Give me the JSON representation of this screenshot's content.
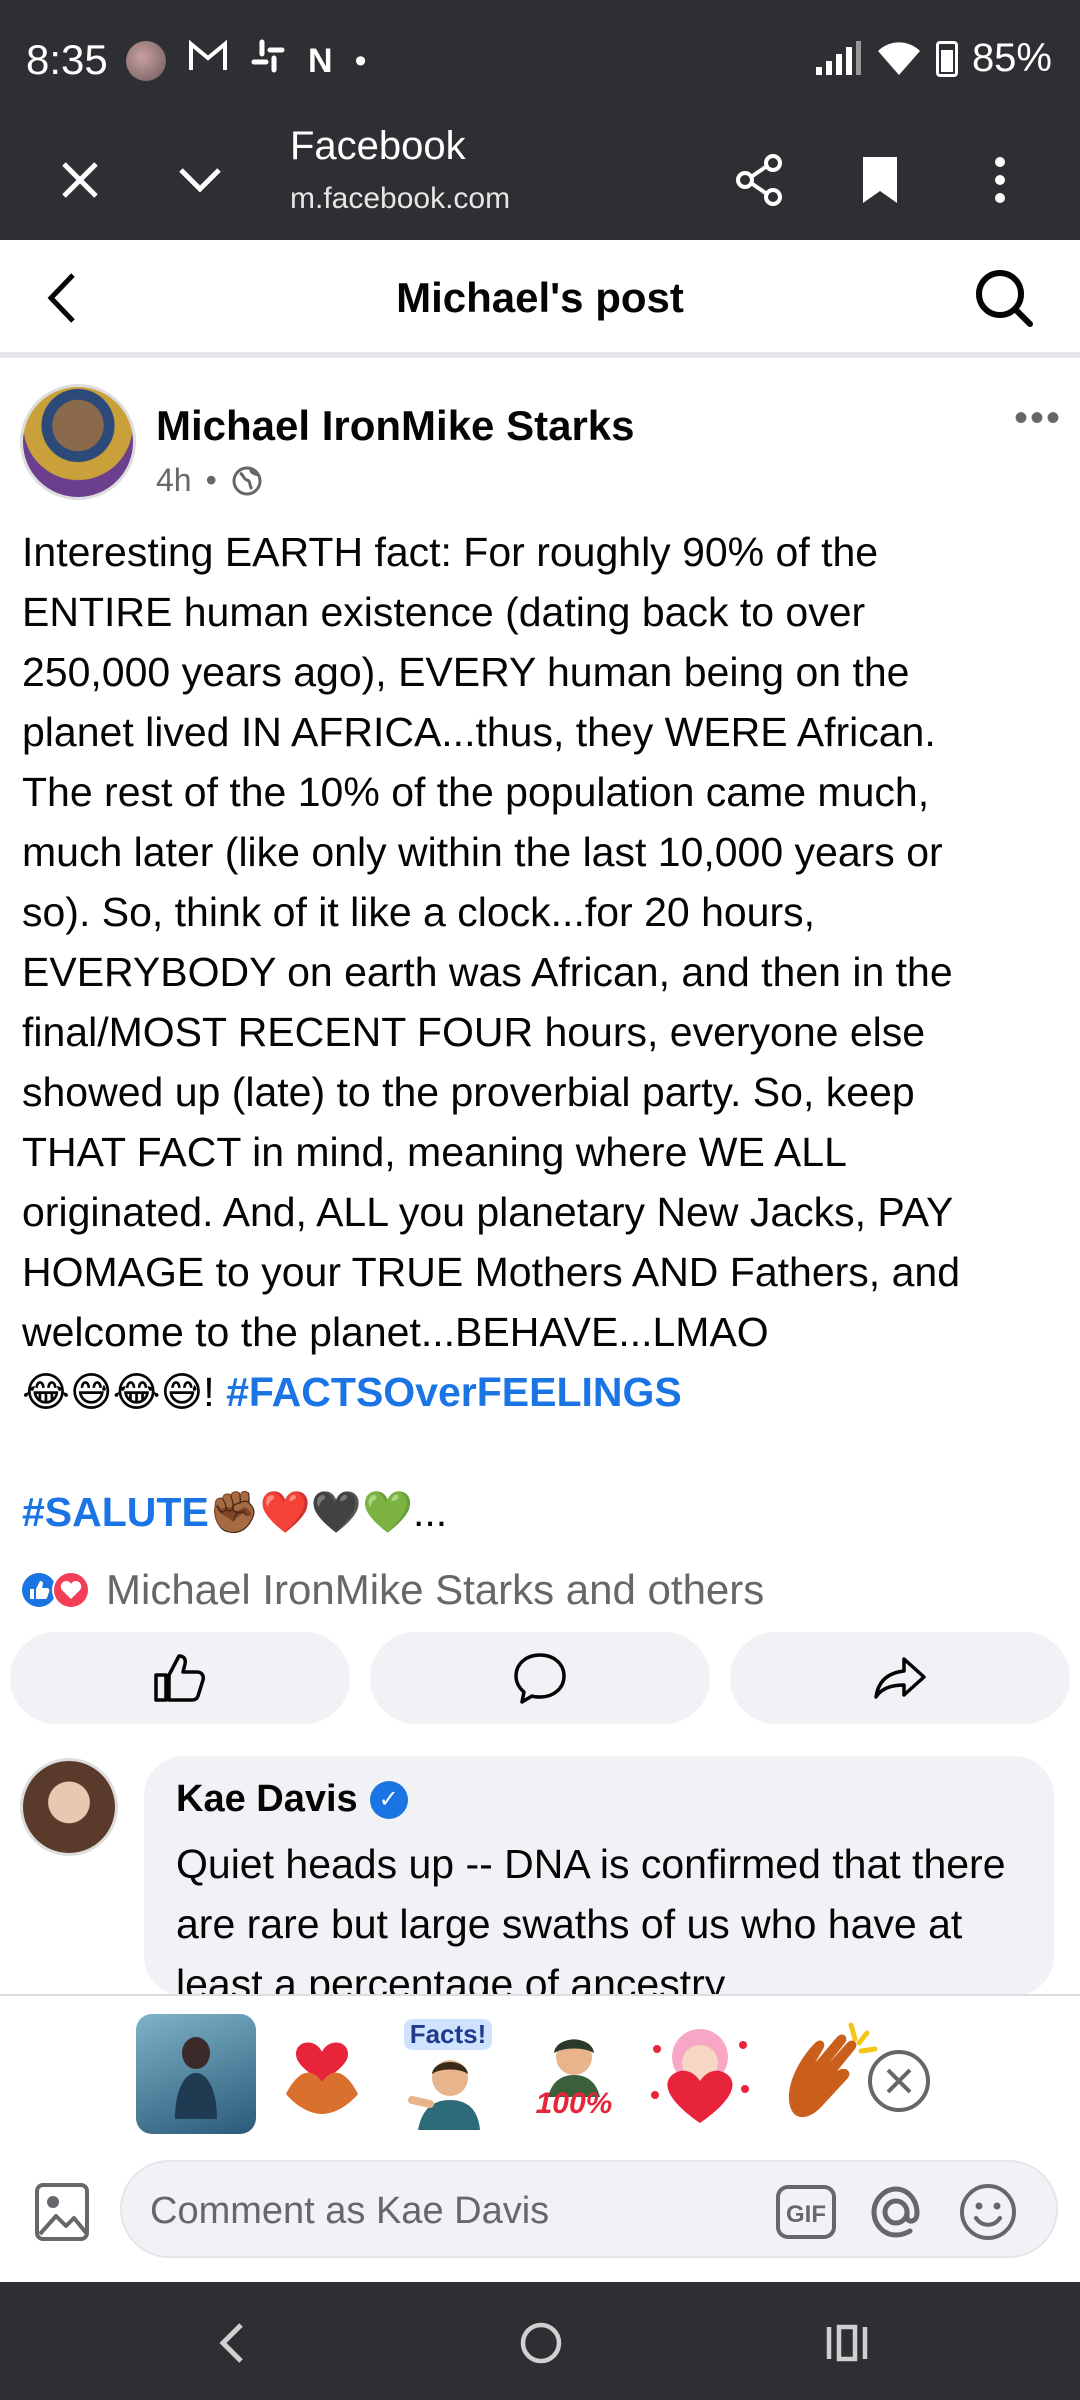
{
  "status_bar": {
    "time": "8:35",
    "icons": [
      "gallery-thumb-icon",
      "gmail-icon",
      "slack-icon",
      "netflix-icon",
      "dot-icon"
    ],
    "battery": "85%"
  },
  "browser": {
    "title": "Facebook",
    "url": "m.facebook.com"
  },
  "header": {
    "title": "Michael's post"
  },
  "post": {
    "author": "Michael IronMike Starks",
    "time": "4h",
    "separator": "•",
    "more": "•••",
    "lines": [
      "Interesting EARTH fact:  For roughly 90% of the",
      "ENTIRE human existence (dating back to over",
      "250,000 years ago), EVERY human being on the",
      "planet lived IN AFRICA...thus, they WERE African.",
      "The rest of the 10% of the population came much,",
      "much later (like only within the last 10,000 years or",
      "so).  So, think of it like a clock...for 20 hours,",
      "EVERYBODY on earth was African, and then in the",
      "final/MOST RECENT FOUR hours, everyone else",
      "showed up (late) to the proverbial party.  So, keep",
      "THAT FACT in mind, meaning where WE ALL",
      "originated.  And, ALL you planetary New Jacks, PAY",
      "HOMAGE to your TRUE Mothers AND Fathers, and",
      "welcome to the planet...BEHAVE...LMAO"
    ],
    "emoji_line_prefix": "😂😅😂😅! ",
    "hashtag1": "#FACTSOverFEELINGS",
    "hashtag2": "#SALUTE",
    "salute_suffix": "✊🏾❤️🖤💚...",
    "reactions_text": "Michael IronMike Starks and others"
  },
  "comment": {
    "author": "Kae Davis",
    "text": "Quiet heads up -- DNA is confirmed that there are rare but large swaths of us who have at least a percentage of ancestry"
  },
  "composer": {
    "placeholder": "Comment as Kae Davis",
    "stickers": [
      "rain-window-sticker",
      "heart-hands-sticker",
      "facts-sticker",
      "hundred-percent-sticker",
      "heart-girl-sticker",
      "clapping-hands-sticker"
    ],
    "facts_label": "Facts!",
    "hundred_label": "100%",
    "gif_label": "GIF"
  },
  "colors": {
    "dark_bar": "#2d2f32",
    "link_blue": "#1b74e4",
    "muted": "#65676b",
    "bubble": "#f0f2f5"
  }
}
